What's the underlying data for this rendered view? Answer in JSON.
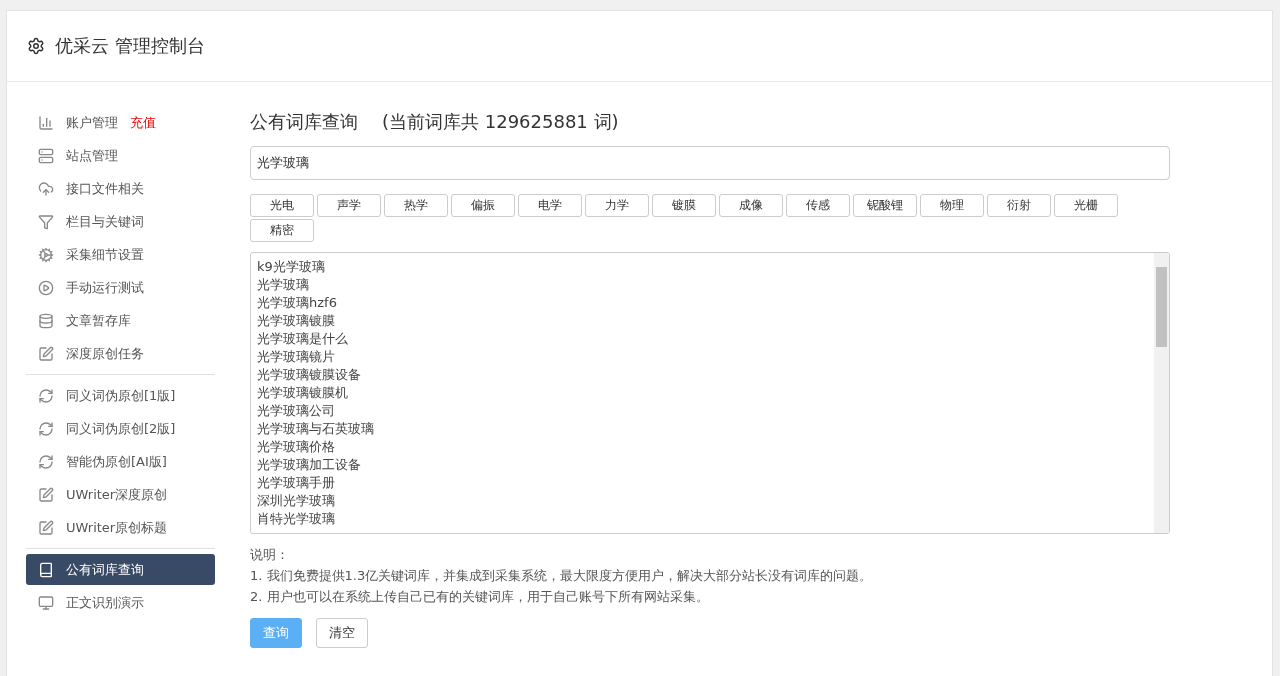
{
  "header": {
    "title": "优采云 管理控制台"
  },
  "sidebar": {
    "groups": [
      {
        "items": [
          {
            "label": "账户管理",
            "badge": "充值",
            "selected": false
          },
          {
            "label": "站点管理",
            "selected": false
          },
          {
            "label": "接口文件相关",
            "selected": false
          },
          {
            "label": "栏目与关键词",
            "selected": false
          },
          {
            "label": "采集细节设置",
            "selected": false
          },
          {
            "label": "手动运行测试",
            "selected": false
          },
          {
            "label": "文章暂存库",
            "selected": false
          },
          {
            "label": "深度原创任务",
            "selected": false
          }
        ]
      },
      {
        "items": [
          {
            "label": "同义词伪原创[1版]",
            "selected": false
          },
          {
            "label": "同义词伪原创[2版]",
            "selected": false
          },
          {
            "label": "智能伪原创[AI版]",
            "selected": false
          },
          {
            "label": "UWriter深度原创",
            "selected": false
          },
          {
            "label": "UWriter原创标题",
            "selected": false
          }
        ]
      },
      {
        "items": [
          {
            "label": "公有词库查询",
            "selected": true
          },
          {
            "label": "正文识别演示",
            "selected": false
          }
        ]
      }
    ]
  },
  "main": {
    "title": "公有词库查询",
    "count": "(当前词库共 129625881 词)",
    "search": {
      "value": "光学玻璃"
    },
    "tags": [
      "光电",
      "声学",
      "热学",
      "偏振",
      "电学",
      "力学",
      "镀膜",
      "成像",
      "传感",
      "铌酸锂",
      "物理",
      "衍射",
      "光栅",
      "精密"
    ],
    "results": [
      "k9光学玻璃",
      "光学玻璃",
      "光学玻璃hzf6",
      "光学玻璃镀膜",
      "光学玻璃是什么",
      "光学玻璃镜片",
      "光学玻璃镀膜设备",
      "光学玻璃镀膜机",
      "光学玻璃公司",
      "光学玻璃与石英玻璃",
      "光学玻璃价格",
      "光学玻璃加工设备",
      "光学玻璃手册",
      "深圳光学玻璃",
      "肖特光学玻璃"
    ],
    "notes_title": "说明：",
    "notes": [
      "1. 我们免费提供1.3亿关键词库，并集成到采集系统，最大限度方便用户，解决大部分站长没有词库的问题。",
      "2. 用户也可以在系统上传自己已有的关键词库，用于自己账号下所有网站采集。"
    ],
    "buttons": [
      {
        "kind": "primary",
        "label": "查询"
      },
      {
        "kind": "default",
        "label": "清空"
      }
    ]
  }
}
